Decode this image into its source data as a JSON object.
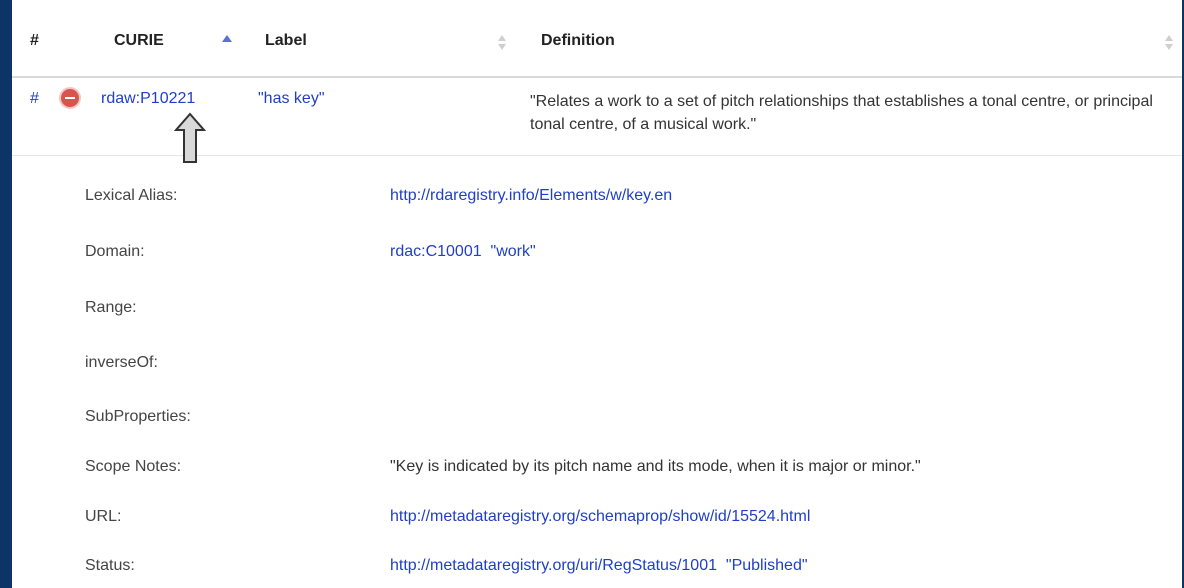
{
  "table": {
    "headers": {
      "hash": "#",
      "curie": "CURIE",
      "label": "Label",
      "definition": "Definition"
    },
    "row": {
      "hash": "#",
      "curie": "rdaw:P10221",
      "label": "\"has key\"",
      "definition": "\"Relates a work to a set of pitch relationships that establishes a tonal centre, or principal tonal centre, of a musical work.\""
    }
  },
  "details": {
    "lexical_alias": {
      "label": "Lexical Alias:",
      "value": "http://rdaregistry.info/Elements/w/key.en"
    },
    "domain": {
      "label": "Domain:",
      "value": "rdac:C10001  \"work\""
    },
    "range": {
      "label": "Range:",
      "value": ""
    },
    "inverse_of": {
      "label": "inverseOf:",
      "value": ""
    },
    "subproperties": {
      "label": "SubProperties:",
      "value": ""
    },
    "scope_notes": {
      "label": "Scope Notes:",
      "value": "\"Key is indicated by its pitch name and its mode, when it is major or minor.\""
    },
    "url": {
      "label": "URL:",
      "value": "http://metadataregistry.org/schemaprop/show/id/15524.html"
    },
    "status": {
      "label": "Status:",
      "value": "http://metadataregistry.org/uri/RegStatus/1001  \"Published\""
    }
  },
  "colors": {
    "background": "#0d3466",
    "link": "#1f3fc4",
    "remove": "#d9534f",
    "sort_active": "#5b6fd8"
  },
  "icons": {
    "remove": "remove-circle-icon",
    "annotation": "up-arrow-icon"
  }
}
